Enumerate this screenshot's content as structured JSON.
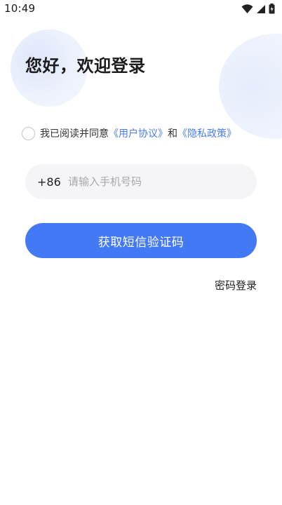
{
  "status_bar": {
    "time": "10:49",
    "icons": [
      "wifi-icon",
      "signal-icon",
      "battery-icon"
    ]
  },
  "greeting": "您好，欢迎登录",
  "agreement": {
    "prefix": "我已阅读并同意",
    "user_agreement": "《用户协议》",
    "conjunction": "和",
    "privacy_policy": "《隐私政策》",
    "checked": false
  },
  "phone": {
    "country_code": "+86",
    "placeholder": "请输入手机号码",
    "value": ""
  },
  "get_code_button": "获取短信验证码",
  "password_login": "密码登录",
  "colors": {
    "primary": "#4479f6",
    "link": "#4a7cf5",
    "input_bg": "#f5f5f7"
  }
}
